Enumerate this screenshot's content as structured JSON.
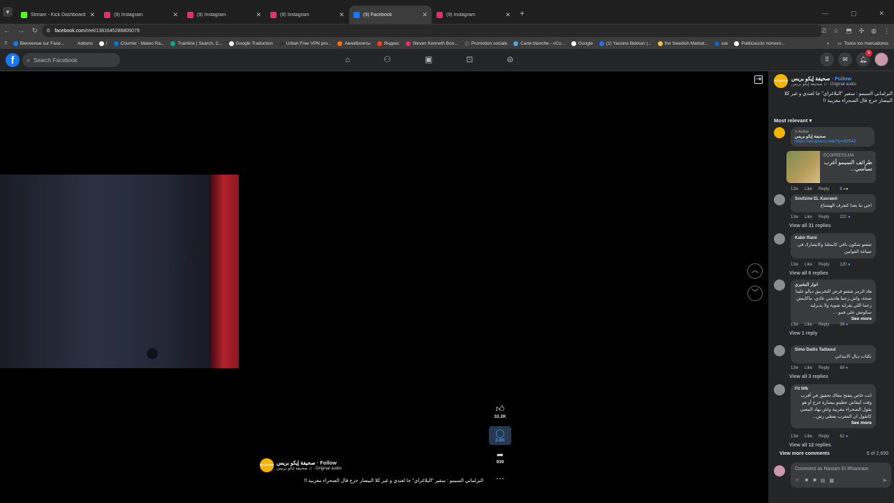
{
  "browser": {
    "tabs": [
      {
        "title": "Stream - Kick Dashboard",
        "color": "#53fc18",
        "active": false
      },
      {
        "title": "(9) Instagram",
        "color": "#e1306c",
        "active": false
      },
      {
        "title": "(9) Instagram",
        "color": "#e1306c",
        "active": false
      },
      {
        "title": "(9) Instagram",
        "color": "#e1306c",
        "active": false
      },
      {
        "title": "(9) Facebook",
        "color": "#1877f2",
        "active": true
      },
      {
        "title": "(9) Instagram",
        "color": "#e1306c",
        "active": false
      }
    ],
    "url_domain": "facebook.com",
    "url_path": "/reel/1381645286805079",
    "bookmarks": [
      {
        "label": "Bienvenue sur Face...",
        "color": "#1877f2"
      },
      {
        "label": "Addons",
        "color": "#3c3c3c"
      },
      {
        "label": "i",
        "color": "#ffffff"
      },
      {
        "label": "Courrier - Mateo Ra...",
        "color": "#0078d4"
      },
      {
        "label": "Trainline | Search, C...",
        "color": "#00a88f"
      },
      {
        "label": "Google Traduction",
        "color": "#ffffff"
      },
      {
        "label": "Urban Free VPN pro...",
        "color": "#333333"
      },
      {
        "label": "Авиабилеты",
        "color": "#ff6f00"
      },
      {
        "label": "Яндекс",
        "color": "#fc3f1d"
      },
      {
        "label": "Steven Kenneth Bon...",
        "color": "#e1306c"
      },
      {
        "label": "Promotion sociale",
        "color": "#555555"
      },
      {
        "label": "Carte blanche - «Co...",
        "color": "#4aa3df"
      },
      {
        "label": "Google",
        "color": "#ffffff"
      },
      {
        "label": "(1) Yassine Bekkari |...",
        "color": "#1877f2"
      },
      {
        "label": "the Swedish Market...",
        "color": "#e8c547"
      },
      {
        "label": "ear",
        "color": "#0a66c2"
      },
      {
        "label": "Publicación número...",
        "color": "#ffffff"
      }
    ],
    "all_bookmarks": "Todos los marcadores"
  },
  "fb": {
    "logo": "f",
    "search_placeholder": "Search Facebook",
    "notif_count": "6"
  },
  "video": {
    "likes": "10.2K",
    "comments": "2.8K",
    "shares": "939",
    "page_name": "صحيفة إيكو بريس",
    "follow": "· Follow",
    "sub": "صحيفة إيكو بريس ♫ · Original audio",
    "caption": "البرلماني السيمو : سفير \"البلاغراي\" جا لعندي و غير كلا البيصار خرج قال الصحراء مغربية !!",
    "logo_text": "ecopress"
  },
  "panel": {
    "page_name": "صحيفة إيكو بريس",
    "follow": "· Follow",
    "sub": "صحيفة إيكو بريس ♫ · Original audio",
    "caption": "البرلماني السيمو : سفير \"البلاغراي\" جا لعندي و غير كلا البيصار خرج قال الصحراء مغربية !!",
    "sort": "Most relevant",
    "author_badge": "✎ Author",
    "author_name": "صحيفة إيكو بريس",
    "author_link": "https://ecopress.ma/?p=92542",
    "og_domain": "ECOPRESS.MA",
    "og_title": "طرائف السيمو أغرب سياسي...",
    "comments": [
      {
        "name": "Soufsine EL Kasrawii",
        "text": "اجي نتا بعدا كتعرف الهشتاغ",
        "time": "13w",
        "count": "222",
        "replies": "View all 31 replies"
      },
      {
        "name": "Kabir Raini",
        "text": "شفتو شكون باقي كايمثلنا وكايشارك في صياغة القوانين",
        "time": "13w",
        "count": "120",
        "replies": "View all 6 replies"
      },
      {
        "name": "انوار البشيري",
        "text": "هاد الزمر شفتو فرض التخربيق ديالو علينا صحة، واش زعما هادشي عادي، ماكاينش زعما اللي يقرايه شوية ولا يديرليه سكوتش على فمو ...",
        "time": "13w",
        "count": "38",
        "replies": "View 1 reply"
      },
      {
        "name": "Simo Dadis Tadlaoui",
        "text": "نكثات ديال الابتدائي",
        "time": "13w",
        "count": "88",
        "replies": "View all 3 replies"
      },
      {
        "name": "Fit Nfb",
        "text": "انت خاص يتفتح معاك تحقيق في أقرب وقت كيفاش عطيتو بيصارة خرج أو هو يقول الصحراء مغربية واش بهاد المعنى كاتقول ان المغرب يعطي رش...",
        "time": "13w",
        "count": "62",
        "replies": "View all 12 replies"
      }
    ],
    "first_time": "13w",
    "first_count": "8",
    "like": "Like",
    "reply": "Reply",
    "see_more": "See more",
    "view_more": "View more comments",
    "counter": "6 of 2,699",
    "compose_placeholder": "Comment as Nassim El Rhannam"
  }
}
